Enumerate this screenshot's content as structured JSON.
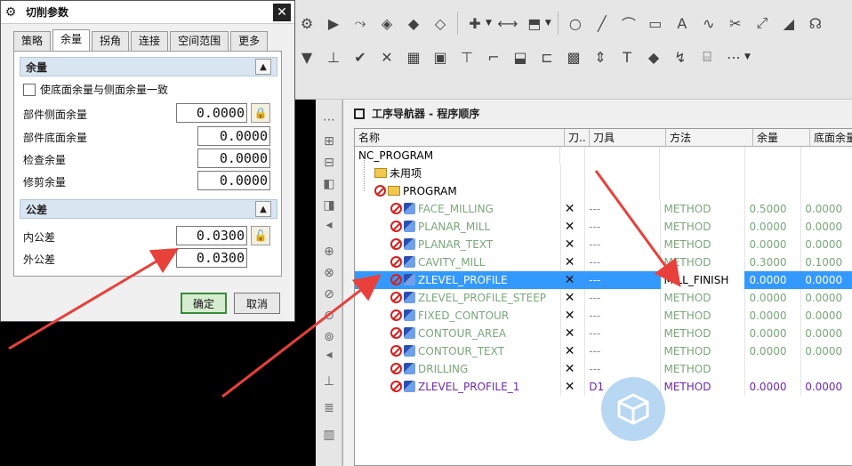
{
  "dialog": {
    "title": "切削参数",
    "tabs": [
      "策略",
      "余量",
      "拐角",
      "连接",
      "空间范围",
      "更多"
    ],
    "active_tab": "余量",
    "stock_group": {
      "title": "余量",
      "checkbox_label": "使底面余量与侧面余量一致",
      "fields": [
        {
          "label": "部件侧面余量",
          "value": "0.0000"
        },
        {
          "label": "部件底面余量",
          "value": "0.0000"
        },
        {
          "label": "检查余量",
          "value": "0.0000"
        },
        {
          "label": "修剪余量",
          "value": "0.0000"
        }
      ]
    },
    "tolerance_group": {
      "title": "公差",
      "fields": [
        {
          "label": "内公差",
          "value": "0.0300"
        },
        {
          "label": "外公差",
          "value": "0.0300"
        }
      ]
    },
    "ok_label": "确定",
    "cancel_label": "取消"
  },
  "navigator": {
    "title": "工序导航器 - 程序顺序",
    "columns": [
      "名称",
      "刀..",
      "刀具",
      "方法",
      "余量",
      "底面余量"
    ],
    "rows": [
      {
        "name": "NC_PROGRAM",
        "tool": "",
        "method": "",
        "stock": "",
        "floor": "",
        "level": 0,
        "kind": "root"
      },
      {
        "name": "未用项",
        "tool": "",
        "method": "",
        "stock": "",
        "floor": "",
        "level": 1,
        "kind": "folder"
      },
      {
        "name": "PROGRAM",
        "tool": "",
        "method": "",
        "stock": "",
        "floor": "",
        "level": 1,
        "kind": "program"
      },
      {
        "name": "FACE_MILLING",
        "tool": "---",
        "method": "METHOD",
        "stock": "0.5000",
        "floor": "0.0000",
        "level": 2,
        "kind": "op"
      },
      {
        "name": "PLANAR_MILL",
        "tool": "---",
        "method": "METHOD",
        "stock": "0.0000",
        "floor": "0.0000",
        "level": 2,
        "kind": "op"
      },
      {
        "name": "PLANAR_TEXT",
        "tool": "---",
        "method": "METHOD",
        "stock": "0.0000",
        "floor": "0.0000",
        "level": 2,
        "kind": "op"
      },
      {
        "name": "CAVITY_MILL",
        "tool": "---",
        "method": "METHOD",
        "stock": "0.3000",
        "floor": "0.1000",
        "level": 2,
        "kind": "op"
      },
      {
        "name": "ZLEVEL_PROFILE",
        "tool": "---",
        "method": "MILL_FINISH",
        "stock": "0.0000",
        "floor": "0.0000",
        "level": 2,
        "kind": "op",
        "selected": true
      },
      {
        "name": "ZLEVEL_PROFILE_STEEP",
        "tool": "---",
        "method": "METHOD",
        "stock": "0.0000",
        "floor": "0.0000",
        "level": 2,
        "kind": "op"
      },
      {
        "name": "FIXED_CONTOUR",
        "tool": "---",
        "method": "METHOD",
        "stock": "0.0000",
        "floor": "0.0000",
        "level": 2,
        "kind": "op"
      },
      {
        "name": "CONTOUR_AREA",
        "tool": "---",
        "method": "METHOD",
        "stock": "0.0000",
        "floor": "0.0000",
        "level": 2,
        "kind": "op"
      },
      {
        "name": "CONTOUR_TEXT",
        "tool": "---",
        "method": "METHOD",
        "stock": "0.0000",
        "floor": "0.0000",
        "level": 2,
        "kind": "op"
      },
      {
        "name": "DRILLING",
        "tool": "---",
        "method": "METHOD",
        "stock": "",
        "floor": "",
        "level": 2,
        "kind": "op"
      },
      {
        "name": "ZLEVEL_PROFILE_1",
        "tool": "D1",
        "method": "METHOD",
        "stock": "0.0000",
        "floor": "0.0000",
        "level": 2,
        "kind": "op",
        "last": true
      }
    ]
  },
  "colors": {
    "selected_row": "#3399ff",
    "inactive_op_text": "#7aa67a",
    "active_op_text": "#6a2aa8",
    "arrow": "#e8403a"
  }
}
